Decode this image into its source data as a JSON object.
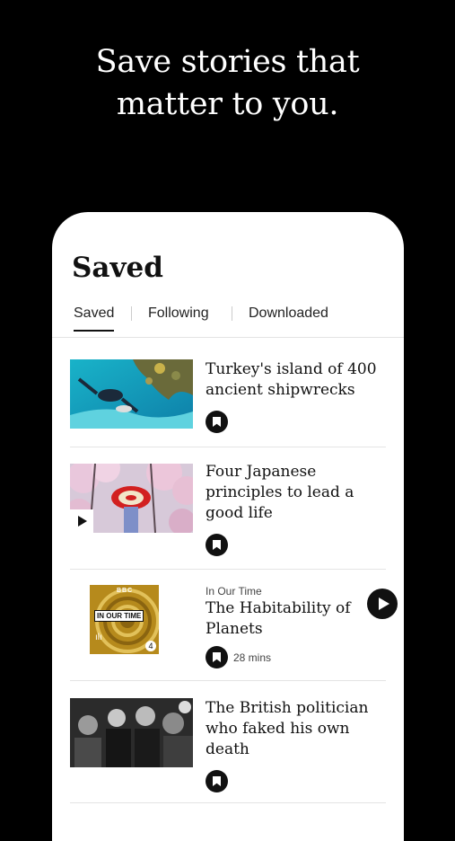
{
  "headline": {
    "line1": "Save stories that",
    "line2": "matter to you."
  },
  "page": {
    "title": "Saved"
  },
  "tabs": [
    {
      "label": "Saved",
      "active": true
    },
    {
      "label": "Following",
      "active": false
    },
    {
      "label": "Downloaded",
      "active": false
    }
  ],
  "stories": [
    {
      "title": "Turkey's island of 400 ancient shipwrecks",
      "image": "diver-underwater",
      "saved": true
    },
    {
      "title": "Four Japanese principles to lead a good life",
      "image": "red-umbrella-cherry-blossom",
      "video": true,
      "saved": true
    },
    {
      "series": "In Our Time",
      "title": "The Habitability of Planets",
      "image": "in-our-time-podcast-art",
      "artwork_label": "IN OUR TIME",
      "artwork_brand": "BBC",
      "artwork_station": "4",
      "duration": "28 mins",
      "saved": true
    },
    {
      "title": "The British politician who faked his own death",
      "image": "black-and-white-crowd-photo",
      "saved": true
    }
  ],
  "colors": {
    "background": "#000000",
    "card": "#ffffff",
    "text": "#111111",
    "accent_gold": "#c9a227"
  }
}
